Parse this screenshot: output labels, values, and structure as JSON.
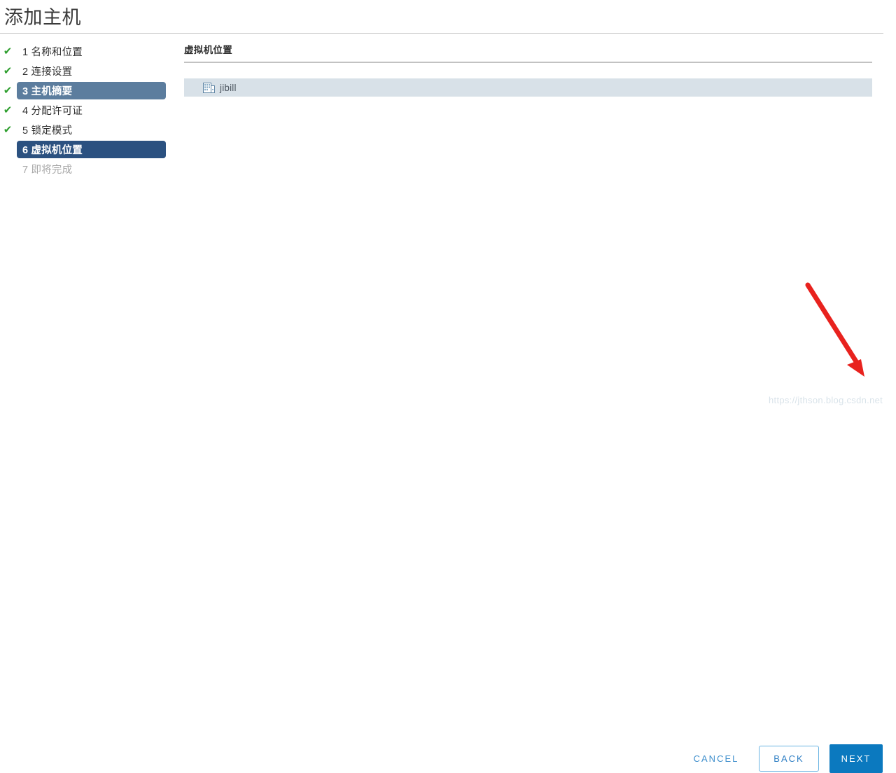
{
  "window": {
    "title": "添加主机"
  },
  "steps": [
    {
      "number": "1",
      "label": "1 名称和位置",
      "state": "completed",
      "check": "✔"
    },
    {
      "number": "2",
      "label": "2 连接设置",
      "state": "completed",
      "check": "✔"
    },
    {
      "number": "3",
      "label": "3 主机摘要",
      "state": "completed-hover",
      "check": "✔"
    },
    {
      "number": "4",
      "label": "4 分配许可证",
      "state": "completed",
      "check": "✔"
    },
    {
      "number": "5",
      "label": "5 锁定模式",
      "state": "completed",
      "check": "✔"
    },
    {
      "number": "6",
      "label": "6 虚拟机位置",
      "state": "current",
      "check": ""
    },
    {
      "number": "7",
      "label": "7 即将完成",
      "state": "disabled",
      "check": ""
    }
  ],
  "content": {
    "heading": "虚拟机位置",
    "tree": [
      {
        "label": "jibill",
        "icon": "datacenter-icon",
        "selected": true
      }
    ]
  },
  "footer": {
    "cancel_label": "CANCEL",
    "back_label": "BACK",
    "next_label": "NEXT"
  },
  "watermark": {
    "text": "https://jthson.blog.csdn.net"
  },
  "colors": {
    "step_current_bg": "#2b5180",
    "step_hover_bg": "#5c7d9e",
    "check_green": "#2d9e2d",
    "selected_row_bg": "#d8e1e8",
    "primary_blue": "#0b79bf",
    "link_blue": "#3f8fcc",
    "arrow_red": "#e8221e"
  }
}
